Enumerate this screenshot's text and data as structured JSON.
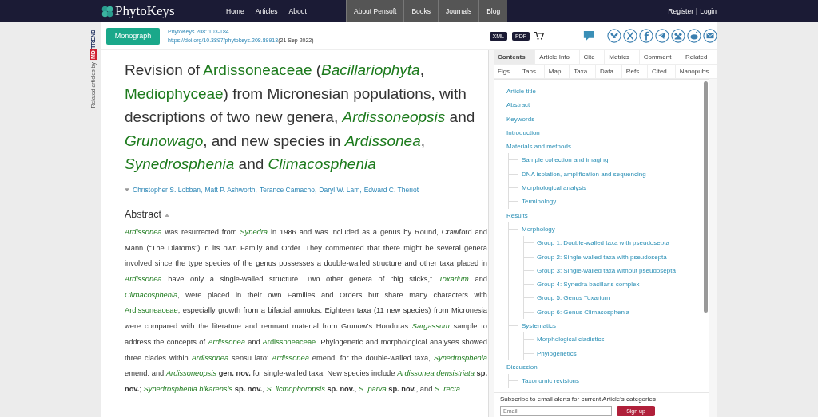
{
  "header": {
    "logo": "PhytoKeys",
    "nav": [
      {
        "label": "Home",
        "kind": "main"
      },
      {
        "label": "Articles",
        "kind": "main"
      },
      {
        "label": "About",
        "kind": "main"
      },
      {
        "label": "About Pensoft",
        "kind": "group"
      },
      {
        "label": "Books",
        "kind": "group"
      },
      {
        "label": "Journals",
        "kind": "group"
      },
      {
        "label": "Blog",
        "kind": "group"
      }
    ],
    "register": "Register",
    "separator": "|",
    "login": "Login"
  },
  "article_bar": {
    "type_button": "Monograph",
    "issue": "PhytoKeys 208: 103-184",
    "doi": "https://doi.org/10.3897/phytokeys.208.89913",
    "date": "(21 Sep 2022)",
    "formats": [
      "XML",
      "PDF"
    ]
  },
  "related": {
    "label": "Related articles by",
    "logo_a": "TREND",
    "logo_b": "MD"
  },
  "title_segments": [
    {
      "kind": "text",
      "text": "Revision of "
    },
    {
      "kind": "taxon",
      "text": "Ardissoneaceae"
    },
    {
      "kind": "text",
      "text": " ("
    },
    {
      "kind": "taxon_italic",
      "text": "Bacillariophyta"
    },
    {
      "kind": "text",
      "text": ", "
    },
    {
      "kind": "taxon",
      "text": "Mediophyceae"
    },
    {
      "kind": "text",
      "text": ") from Micronesian populations, with descriptions of two new genera, "
    },
    {
      "kind": "taxon_italic",
      "text": "Ardissoneopsis"
    },
    {
      "kind": "text",
      "text": " and "
    },
    {
      "kind": "taxon_italic",
      "text": "Grunowago"
    },
    {
      "kind": "text",
      "text": ", and new species in "
    },
    {
      "kind": "taxon_italic",
      "text": "Ardissonea"
    },
    {
      "kind": "text",
      "text": ", "
    },
    {
      "kind": "taxon_italic",
      "text": "Synedrosphenia"
    },
    {
      "kind": "text",
      "text": " and "
    },
    {
      "kind": "taxon_italic",
      "text": "Climacosphenia"
    }
  ],
  "authors": [
    "Christopher S. Lobban,",
    "Matt P. Ashworth,",
    "Terance Camacho,",
    "Daryl W. Lam,",
    "Edward C. Theriot"
  ],
  "abstract_heading": "Abstract",
  "abstract_segments": [
    {
      "kind": "taxon_italic",
      "text": "Ardissonea"
    },
    {
      "kind": "text",
      "text": " was resurrected from "
    },
    {
      "kind": "taxon_italic",
      "text": "Synedra"
    },
    {
      "kind": "text",
      "text": " in 1986 and was included as a genus by Round, Crawford and Mann (“The Diatoms”) in its own Family and Order. They commented that there might be several genera involved since the type species of the genus possesses a double-walled structure and other taxa placed in "
    },
    {
      "kind": "taxon_italic",
      "text": "Ardissonea"
    },
    {
      "kind": "text",
      "text": " have only a single-walled structure. Two other genera of “big sticks,” "
    },
    {
      "kind": "taxon_italic",
      "text": "Toxarium"
    },
    {
      "kind": "text",
      "text": " and "
    },
    {
      "kind": "taxon_italic",
      "text": "Climacosphenia"
    },
    {
      "kind": "text",
      "text": ", were placed in their own Families and Orders but share many characters with "
    },
    {
      "kind": "taxon",
      "text": "Ardissoneaceae"
    },
    {
      "kind": "text",
      "text": ", especially growth from a bifacial annulus. Eighteen taxa (11 new species) from Micronesia were compared with the literature and remnant material from Grunow’s Honduras "
    },
    {
      "kind": "taxon_italic",
      "text": "Sargassum"
    },
    {
      "kind": "text",
      "text": " sample to address the concepts of "
    },
    {
      "kind": "taxon_italic",
      "text": "Ardissonea"
    },
    {
      "kind": "text",
      "text": " and "
    },
    {
      "kind": "taxon",
      "text": "Ardissoneaceae"
    },
    {
      "kind": "text",
      "text": ". Phylogenetic and morphological analyses showed three clades within "
    },
    {
      "kind": "taxon_italic",
      "text": "Ardissonea"
    },
    {
      "kind": "text",
      "text": " sensu lato: "
    },
    {
      "kind": "taxon_italic",
      "text": "Ardissonea"
    },
    {
      "kind": "text",
      "text": " emend. for the double-walled taxa, "
    },
    {
      "kind": "taxon_italic",
      "text": "Synedrosphenia"
    },
    {
      "kind": "text",
      "text": " emend. and "
    },
    {
      "kind": "taxon_italic",
      "text": "Ardissoneopsis"
    },
    {
      "kind": "bold",
      "text": " gen. nov."
    },
    {
      "kind": "text",
      "text": " for single-walled taxa. New species include "
    },
    {
      "kind": "taxon_italic",
      "text": "Ardissonea densistriata"
    },
    {
      "kind": "bold",
      "text": " sp. nov."
    },
    {
      "kind": "text",
      "text": "; "
    },
    {
      "kind": "taxon_italic",
      "text": "Synedrosphenia bikarensis"
    },
    {
      "kind": "bold",
      "text": " sp. nov."
    },
    {
      "kind": "text",
      "text": ", "
    },
    {
      "kind": "taxon_italic",
      "text": "S. licmophoropsis"
    },
    {
      "kind": "bold",
      "text": " sp. nov."
    },
    {
      "kind": "text",
      "text": ", "
    },
    {
      "kind": "taxon_italic",
      "text": "S. parva"
    },
    {
      "kind": "bold",
      "text": " sp. nov."
    },
    {
      "kind": "text",
      "text": ", and "
    },
    {
      "kind": "taxon_italic",
      "text": "S. recta"
    }
  ],
  "tabs_row_1": [
    {
      "label": "Contents",
      "selected": true
    },
    {
      "label": "Article Info",
      "selected": false
    },
    {
      "label": "Cite",
      "selected": false
    },
    {
      "label": "Metrics",
      "selected": false
    },
    {
      "label": "Comment",
      "selected": false
    },
    {
      "label": "Related",
      "selected": false
    }
  ],
  "tabs_row_2": [
    {
      "label": "Figs",
      "selected": false
    },
    {
      "label": "Tabs",
      "selected": false
    },
    {
      "label": "Map",
      "selected": false
    },
    {
      "label": "Taxa",
      "selected": false
    },
    {
      "label": "Data",
      "selected": false
    },
    {
      "label": "Refs",
      "selected": false
    },
    {
      "label": "Cited",
      "selected": false
    },
    {
      "label": "Nanopubs",
      "selected": false
    }
  ],
  "contents": [
    {
      "label": "Article title"
    },
    {
      "label": "Abstract"
    },
    {
      "label": "Keywords"
    },
    {
      "label": "Introduction"
    },
    {
      "label": "Materials and methods",
      "children": [
        {
          "label": "Sample collection and imaging"
        },
        {
          "label": "DNA isolation, amplification and sequencing"
        },
        {
          "label": "Morphological analysis"
        },
        {
          "label": "Terminology"
        }
      ]
    },
    {
      "label": "Results",
      "children": [
        {
          "label": "Morphology",
          "children": [
            {
              "label": "Group 1: Double-walled taxa with pseudosepta"
            },
            {
              "label": "Group 2: Single-walled taxa with pseudosepta"
            },
            {
              "label": "Group 3: Single-walled taxa without pseudosepta"
            },
            {
              "label": "Group 4: Synedra bacillaris complex"
            },
            {
              "label": "Group 5: Genus Toxarium"
            },
            {
              "label": "Group 6: Genus Climacosphenia"
            }
          ]
        },
        {
          "label": "Systematics",
          "children": [
            {
              "label": "Morphological cladistics"
            },
            {
              "label": "Phylogenetics"
            }
          ]
        }
      ]
    },
    {
      "label": "Discussion",
      "children": [
        {
          "label": "Taxonomic revisions"
        }
      ]
    }
  ],
  "subscribe": {
    "text": "Subscribe to email alerts for current Article's categories",
    "placeholder": "Email",
    "button": "Sign up"
  }
}
